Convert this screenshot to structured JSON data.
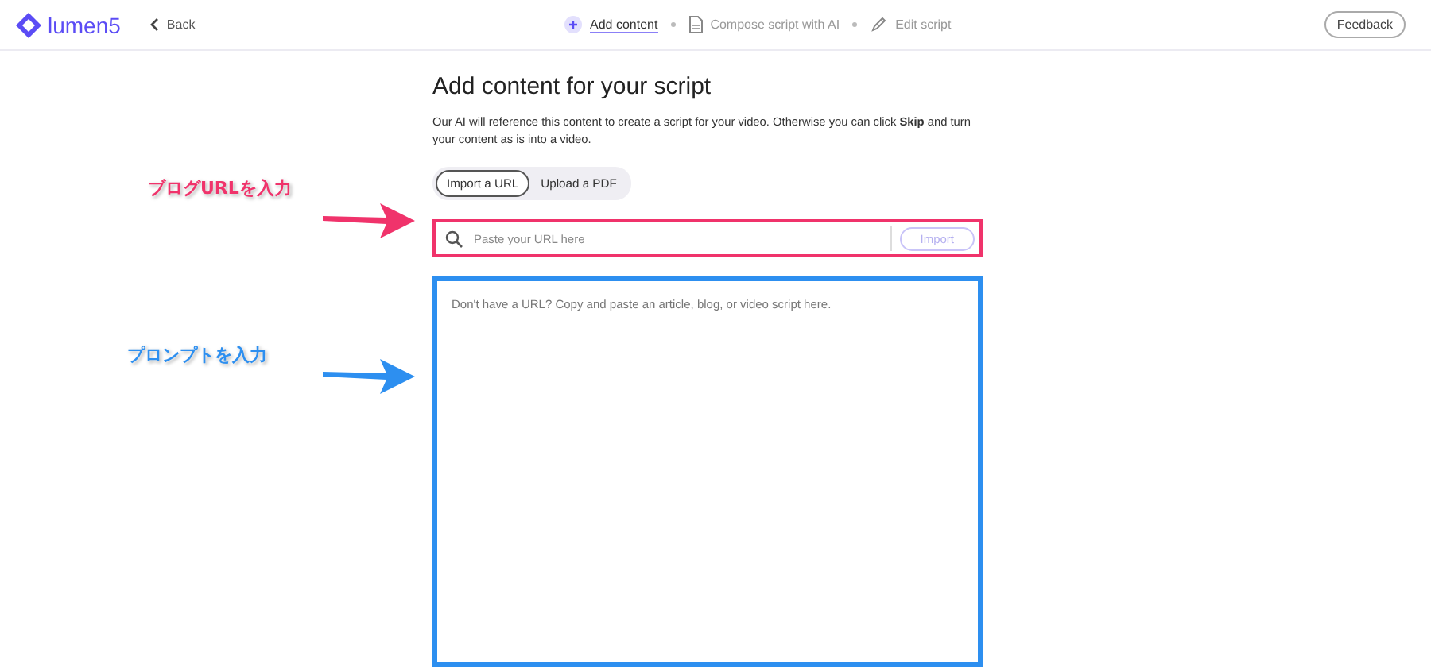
{
  "header": {
    "logo": "lumen5",
    "back": "Back",
    "steps": [
      {
        "label": "Add content",
        "kind": "add",
        "selected": true
      },
      {
        "label": "Compose script with AI",
        "kind": "document",
        "selected": false
      },
      {
        "label": "Edit script",
        "kind": "pencil",
        "selected": false
      }
    ],
    "feedback": "Feedback"
  },
  "title": "Add content for your script",
  "description": "Our AI will reference this content to create a script for your video. Otherwise you can click **Skip** and turn your content as is into a video.",
  "tabs": [
    {
      "label": "Import a URL",
      "selected": true
    },
    {
      "label": "Upload a PDF",
      "selected": false
    }
  ],
  "url_field": {
    "placeholder": "Paste your URL here",
    "button": "Import"
  },
  "content_field": {
    "placeholder": "Don't have a URL? Copy and paste an article, blog, or video script here."
  },
  "annotations": [
    {
      "text": "ブログURLを入力",
      "color": "#f0336b"
    },
    {
      "text": "プロンプトを入力",
      "color": "#2d8ff0"
    }
  ]
}
